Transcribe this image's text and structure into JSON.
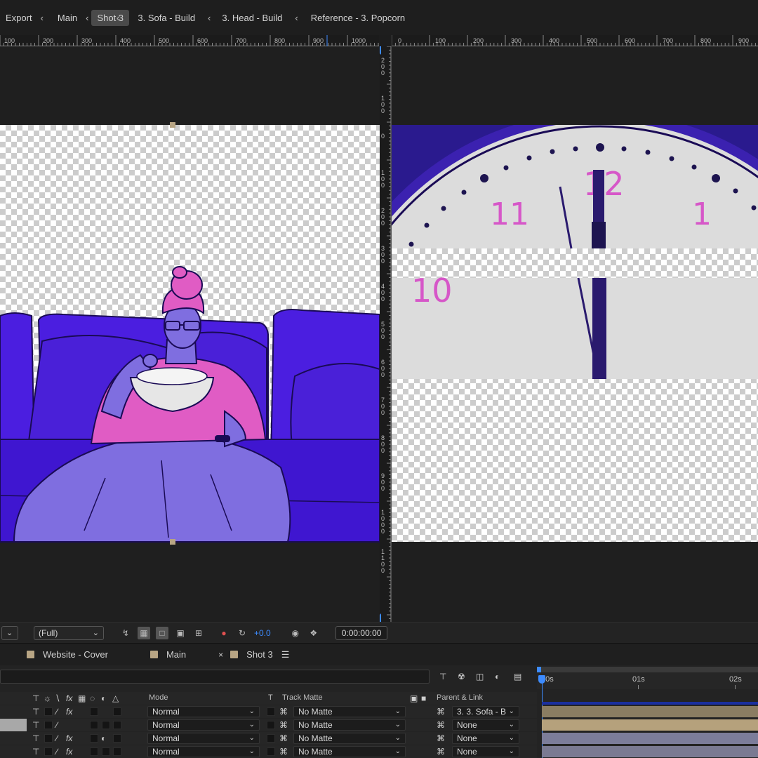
{
  "breadcrumbs": [
    {
      "label": "Export"
    },
    {
      "label": "Main"
    },
    {
      "label": "Shot 3",
      "active": true
    },
    {
      "label": "3. Sofa - Build"
    },
    {
      "label": "3. Head - Build"
    },
    {
      "label": "Reference - 3. Popcorn"
    }
  ],
  "ruler_left": {
    "labels": [
      "100",
      "200",
      "300",
      "400",
      "500",
      "600",
      "700",
      "800",
      "900",
      "1000"
    ]
  },
  "ruler_right": {
    "labels": [
      "0",
      "100",
      "200",
      "300",
      "400",
      "500",
      "600",
      "700",
      "800",
      "900"
    ]
  },
  "ruler_vertical": {
    "labels": [
      "2 0 0",
      "1 0 0",
      "0",
      "1 0 0",
      "2 0 0",
      "3 0 0",
      "4 0 0",
      "5 0 0",
      "6 0 0",
      "7 0 0",
      "8 0 0",
      "9 0 0",
      "1 0 0 0",
      "1 1 0 0"
    ]
  },
  "clock": {
    "numerals": [
      "12",
      "11",
      "1",
      "10"
    ]
  },
  "viewer_toolbar": {
    "resolution": "(Full)",
    "exposure": "+0.0",
    "timecode": "0:00:00:00"
  },
  "timeline_tabs": [
    {
      "label": "Website - Cover",
      "closable": false
    },
    {
      "label": "Main",
      "closable": false
    },
    {
      "label": "Shot 3",
      "closable": true,
      "active": true
    }
  ],
  "time_ruler": {
    "labels": [
      "00s",
      "01s",
      "02s"
    ]
  },
  "columns": {
    "mode": "Mode",
    "t": "T",
    "track_matte": "Track Matte",
    "parent": "Parent & Link"
  },
  "layers": [
    {
      "mode": "Normal",
      "matte": "No Matte",
      "parent": "3. 3. Sofa - B",
      "bar_color": "#8a7d62"
    },
    {
      "mode": "Normal",
      "matte": "No Matte",
      "parent": "None",
      "bar_color": "#b5a17c"
    },
    {
      "mode": "Normal",
      "matte": "No Matte",
      "parent": "None",
      "bar_color": "#7c7d9a"
    },
    {
      "mode": "Normal",
      "matte": "No Matte",
      "parent": "None",
      "bar_color": "#7a7a92"
    }
  ],
  "colors": {
    "accent": "#3d8bff",
    "sofa": "#4b1ee0",
    "skin": "#7f6ee0",
    "shirt": "#e05cc4",
    "clock_purple": "#2a1a6e"
  }
}
